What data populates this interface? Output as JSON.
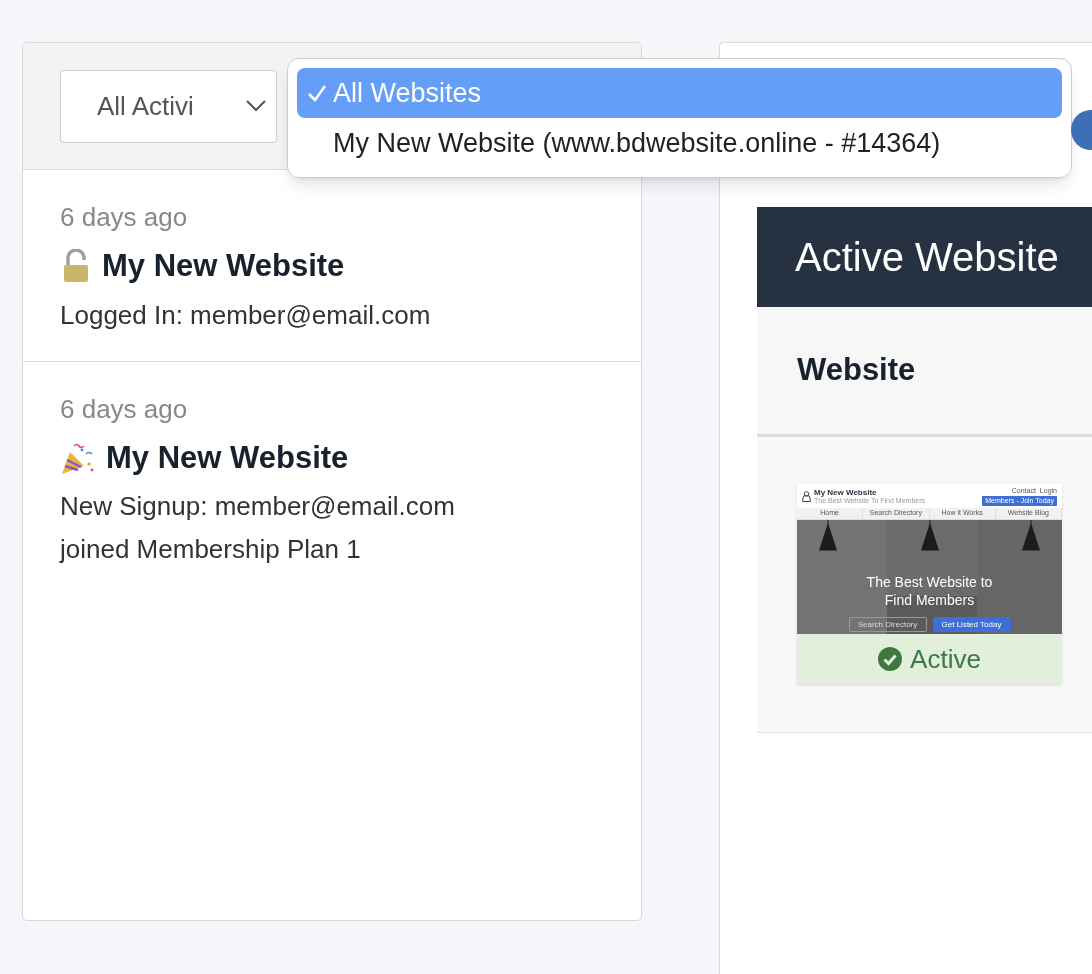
{
  "filter": {
    "value": "All Activi"
  },
  "website_menu": {
    "options": [
      {
        "label": "All Websites",
        "selected": true
      },
      {
        "label": "My New Website (www.bdwebsite.online - #14364)",
        "selected": false
      }
    ]
  },
  "activities": [
    {
      "kind": "login",
      "time": "6 days ago",
      "title": "My New Website",
      "lines": [
        "Logged In: member@email.com"
      ]
    },
    {
      "kind": "signup",
      "time": "6 days ago",
      "title": "My New Website",
      "lines": [
        "New Signup: member@email.com",
        "joined Membership Plan 1"
      ]
    }
  ],
  "websites_panel": {
    "title": "Active Website",
    "column": "Website",
    "rows": [
      {
        "status": "Active",
        "preview": {
          "site_title": "My New Website",
          "tagline": "The Best Website To Find Members",
          "top_links": [
            "Contact",
            "Login"
          ],
          "cta": "Members - Join Today",
          "nav": [
            "Home",
            "Search Directory",
            "How it Works",
            "Website Blog"
          ],
          "hero_title": "The Best Website to Find Members",
          "hero_buttons": [
            "Search Directory",
            "Get Listed Today"
          ]
        }
      }
    ]
  }
}
